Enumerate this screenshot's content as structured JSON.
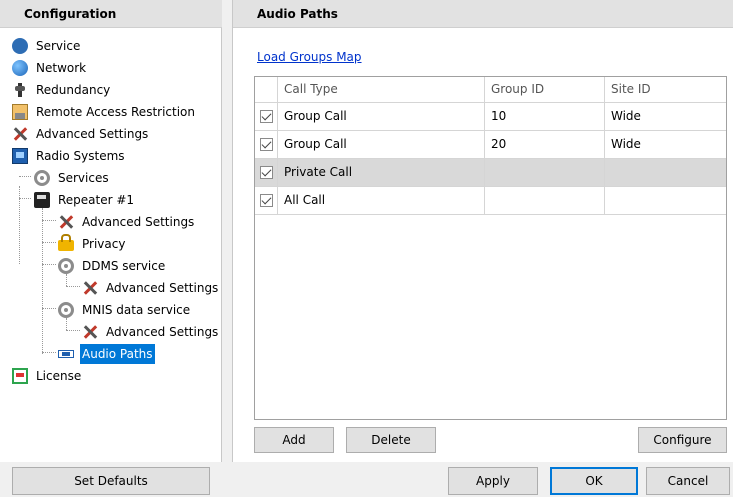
{
  "left": {
    "title": "Configuration",
    "tree": [
      {
        "label": "Service",
        "icon": "gear-icon"
      },
      {
        "label": "Network",
        "icon": "globe-icon"
      },
      {
        "label": "Redundancy",
        "icon": "plug-icon"
      },
      {
        "label": "Remote Access Restriction",
        "icon": "document-icon"
      },
      {
        "label": "Advanced Settings",
        "icon": "tools-icon"
      },
      {
        "label": "Radio Systems",
        "icon": "radio-system-icon"
      },
      {
        "label": "Services",
        "icon": "cog-icon"
      },
      {
        "label": "Repeater #1",
        "icon": "repeater-icon"
      },
      {
        "label": "Advanced Settings",
        "icon": "tools-icon"
      },
      {
        "label": "Privacy",
        "icon": "lock-icon"
      },
      {
        "label": "DDMS service",
        "icon": "cog-icon"
      },
      {
        "label": "Advanced Settings",
        "icon": "tools-icon"
      },
      {
        "label": "MNIS data service",
        "icon": "cog-icon"
      },
      {
        "label": "Advanced Settings",
        "icon": "tools-icon"
      },
      {
        "label": "Audio Paths",
        "icon": "audio-paths-icon"
      },
      {
        "label": "License",
        "icon": "license-icon"
      }
    ],
    "selected": "Audio Paths"
  },
  "right": {
    "title": "Audio Paths",
    "load_link": "Load Groups Map",
    "columns": [
      "Call Type",
      "Group ID",
      "Site ID"
    ],
    "rows": [
      {
        "checked": true,
        "call_type": "Group Call",
        "group_id": "10",
        "site_id": "Wide"
      },
      {
        "checked": true,
        "call_type": "Group Call",
        "group_id": "20",
        "site_id": "Wide"
      },
      {
        "checked": true,
        "call_type": "Private Call",
        "group_id": "",
        "site_id": ""
      },
      {
        "checked": true,
        "call_type": "All Call",
        "group_id": "",
        "site_id": ""
      }
    ],
    "buttons": {
      "add": "Add",
      "delete": "Delete",
      "configure": "Configure"
    }
  },
  "footer": {
    "set_defaults": "Set Defaults",
    "apply": "Apply",
    "ok": "OK",
    "cancel": "Cancel"
  },
  "colors": {
    "selection": "#0078d7",
    "link": "#0033cc",
    "highlight_row": "#d9d9d9"
  }
}
